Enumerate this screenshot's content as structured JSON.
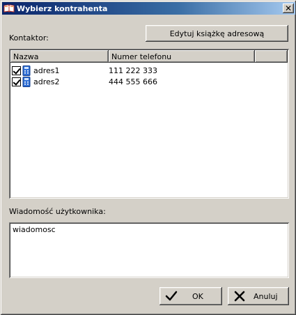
{
  "window": {
    "title": "Wybierz kontrahenta",
    "close_glyph": "✕",
    "title_icon": "book-icon"
  },
  "toolbar": {
    "edit_address_book_label": "Edytuj książkę adresową"
  },
  "contacts": {
    "label": "Kontaktor:",
    "columns": [
      "Nazwa",
      "Numer telefonu"
    ],
    "rows": [
      {
        "name": "adres1",
        "phone": "111 222 333",
        "checked": true,
        "icon": "phone-icon"
      },
      {
        "name": "adres2",
        "phone": "444 555 666",
        "checked": true,
        "icon": "phone-icon"
      }
    ]
  },
  "message": {
    "label": "Wiadomość użytkownika:",
    "value": "wiadomosc"
  },
  "buttons": {
    "ok_label": "OK",
    "cancel_label": "Anuluj"
  },
  "colors": {
    "titlebar_start": "#0a246a",
    "titlebar_end": "#a6caf0",
    "face": "#d4d0c8"
  }
}
